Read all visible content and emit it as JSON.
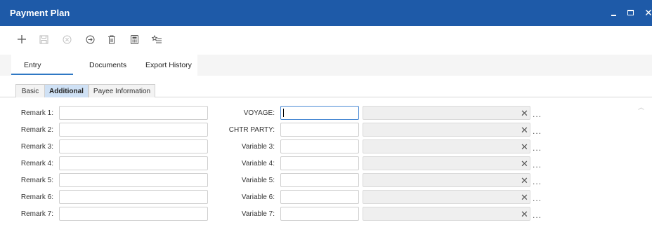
{
  "window": {
    "title": "Payment Plan",
    "controls": {
      "minimize": "–",
      "maximize": "☐",
      "close": "✕"
    }
  },
  "toolbar": {
    "buttons": [
      {
        "name": "add",
        "icon": "plus-icon",
        "enabled": true
      },
      {
        "name": "save",
        "icon": "save-icon",
        "enabled": false
      },
      {
        "name": "cancel",
        "icon": "cancel-circle-icon",
        "enabled": false
      },
      {
        "name": "next",
        "icon": "arrow-circle-right-icon",
        "enabled": true
      },
      {
        "name": "delete",
        "icon": "trash-icon",
        "enabled": true
      },
      {
        "name": "calculator",
        "icon": "calculator-icon",
        "enabled": true
      },
      {
        "name": "favorites",
        "icon": "star-list-icon",
        "enabled": true
      }
    ]
  },
  "tabs": [
    {
      "label": "Entry",
      "active": true
    },
    {
      "label": "Documents",
      "active": false
    },
    {
      "label": "Export History",
      "active": false
    }
  ],
  "subtabs": [
    {
      "label": "Basic",
      "active": false
    },
    {
      "label": "Additional",
      "active": true
    },
    {
      "label": "Payee Information",
      "active": false
    }
  ],
  "form": {
    "remarks": [
      {
        "label": "Remark 1:",
        "value": ""
      },
      {
        "label": "Remark 2:",
        "value": ""
      },
      {
        "label": "Remark 3:",
        "value": ""
      },
      {
        "label": "Remark 4:",
        "value": ""
      },
      {
        "label": "Remark 5:",
        "value": ""
      },
      {
        "label": "Remark 6:",
        "value": ""
      },
      {
        "label": "Remark 7:",
        "value": ""
      }
    ],
    "variables": [
      {
        "label": "VOYAGE:",
        "value": "",
        "focused": true
      },
      {
        "label": "CHTR PARTY:",
        "value": "",
        "focused": false
      },
      {
        "label": "Variable 3:",
        "value": "",
        "focused": false
      },
      {
        "label": "Variable 4:",
        "value": "",
        "focused": false
      },
      {
        "label": "Variable 5:",
        "value": "",
        "focused": false
      },
      {
        "label": "Variable 6:",
        "value": "",
        "focused": false
      },
      {
        "label": "Variable 7:",
        "value": "",
        "focused": false
      }
    ],
    "clear_glyph": "✕",
    "lookup_glyph": "..."
  },
  "colors": {
    "titlebar": "#1e5aa8",
    "active_subtab": "#cfe1f5",
    "tab_underline": "#2f78c4",
    "focus_border": "#4b8ad4"
  }
}
